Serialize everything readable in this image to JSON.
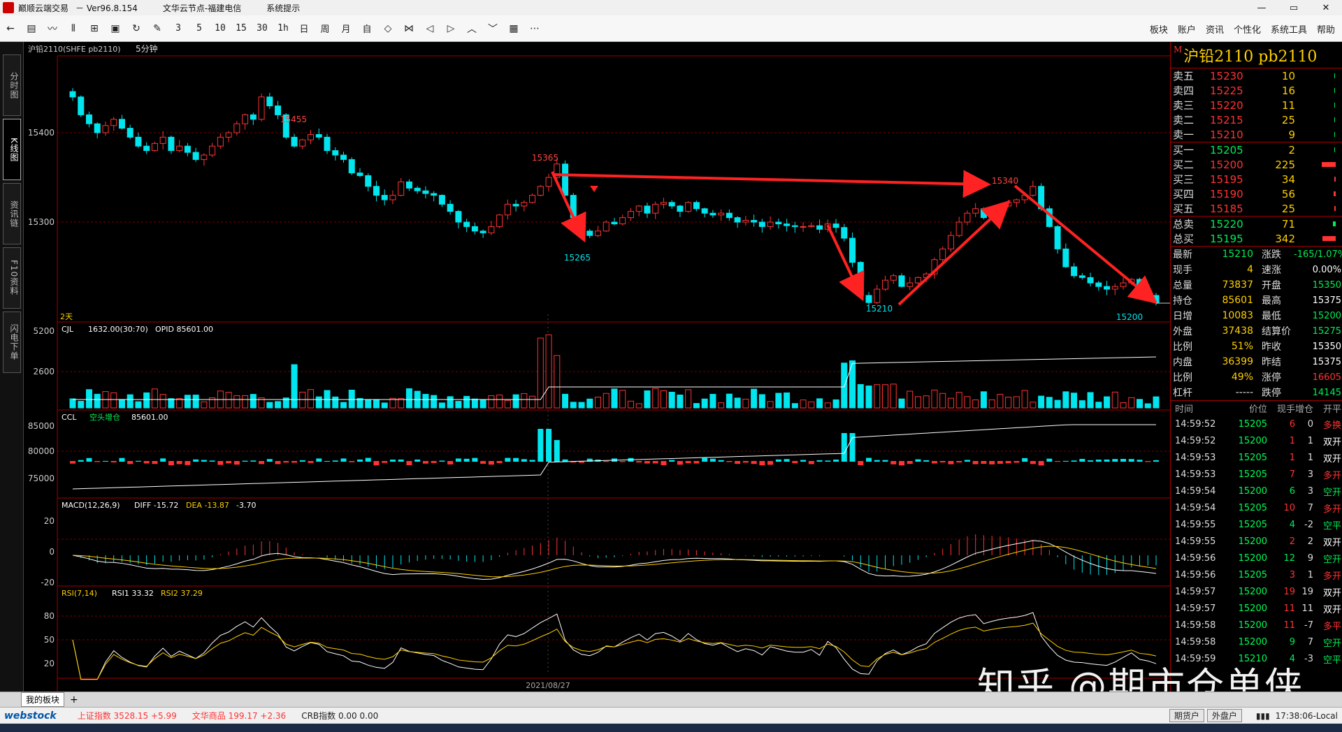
{
  "window": {
    "app_name": "巅顺云端交易",
    "version": "－ Ver96.8.154",
    "server": "文华云节点-福建电信",
    "menu_label": "系统提示",
    "buttons": [
      "—",
      "▭",
      "✕"
    ]
  },
  "toolbar": {
    "icons": [
      "back-icon",
      "home-icon",
      "line-chart-icon",
      "compare-icon",
      "split-icon",
      "save-icon",
      "refresh-icon",
      "draw-icon"
    ],
    "periods": [
      "3",
      "5",
      "10",
      "15",
      "30",
      "1h",
      "日",
      "周",
      "月",
      "自"
    ],
    "tail_icons": [
      "diamond-icon",
      "bowtie-icon",
      "prev-icon",
      "next-icon",
      "up-icon",
      "down-icon",
      "layout-icon",
      "more-icon"
    ],
    "menu": [
      "板块",
      "账户",
      "资讯",
      "个性化",
      "系统工具",
      "帮助"
    ]
  },
  "left_tabs": [
    "分时图",
    "K线图",
    "资讯链",
    "F10资料",
    "闪电下单"
  ],
  "chart_header": {
    "symbol": "沪铅2110(SHFE pb2110)",
    "period": "5分钟"
  },
  "chart_data": {
    "type": "candlestick",
    "y_ticks": [
      "15400",
      "15300"
    ],
    "annotations": {
      "high1": "15455",
      "peak2": "15365",
      "low1": "15265",
      "peak3": "15340",
      "low2": "15210",
      "low3": "15200"
    },
    "period_label": "2天",
    "x_label": "2021/08/27",
    "closes": [
      15440,
      15420,
      15410,
      15400,
      15408,
      15415,
      15405,
      15395,
      15385,
      15380,
      15388,
      15395,
      15380,
      15385,
      15378,
      15370,
      15375,
      15385,
      15395,
      15400,
      15410,
      15420,
      15415,
      15440,
      15430,
      15420,
      15395,
      15385,
      15392,
      15398,
      15395,
      15380,
      15375,
      15370,
      15355,
      15352,
      15340,
      15330,
      15325,
      15330,
      15345,
      15338,
      15335,
      15332,
      15330,
      15320,
      15312,
      15300,
      15295,
      15290,
      15288,
      15295,
      15308,
      15320,
      15318,
      15322,
      15330,
      15340,
      15350,
      15365,
      15330,
      15305,
      15290,
      15285,
      15290,
      15300,
      15298,
      15305,
      15312,
      15318,
      15310,
      15320,
      15322,
      15318,
      15312,
      15322,
      15315,
      15310,
      15308,
      15310,
      15305,
      15300,
      15302,
      15300,
      15295,
      15300,
      15298,
      15296,
      15295,
      15295,
      15296,
      15292,
      15298,
      15294,
      15282,
      15255,
      15218,
      15210,
      15225,
      15235,
      15240,
      15228,
      15232,
      15238,
      15242,
      15258,
      15270,
      15285,
      15300,
      15310,
      15315,
      15305,
      15312,
      15318,
      15322,
      15325,
      15330,
      15340,
      15315,
      15295,
      15270,
      15250,
      15240,
      15238,
      15232,
      15228,
      15225,
      15228,
      15232,
      15236,
      15222,
      15218,
      15210
    ],
    "volume_series": {
      "name": "CJL",
      "values_label": "1632.00(30:70)",
      "extra": "OPID 85601.00",
      "ticks": [
        "5200",
        "2600"
      ]
    },
    "oi_series": {
      "name": "CCL",
      "tag": "空头增仓",
      "value": "85601.00",
      "ticks": [
        "85000",
        "80000",
        "75000"
      ]
    },
    "macd": {
      "name": "MACD(12,26,9)",
      "diff": "DIFF -15.72",
      "dea": "DEA -13.87",
      "macd": "-3.70",
      "ticks": [
        "20",
        "0",
        "-20"
      ]
    },
    "rsi": {
      "name": "RSI(7,14)",
      "rsi1": "RSI1 33.32",
      "rsi2": "RSI2 37.29",
      "ticks": [
        "80",
        "50",
        "20"
      ]
    }
  },
  "quote": {
    "tag": "M",
    "title": "沪铅2110  pb2110",
    "asks": [
      {
        "label": "卖五",
        "price": "15230",
        "qty": "10",
        "bar": 0
      },
      {
        "label": "卖四",
        "price": "15225",
        "qty": "16",
        "bar": 0
      },
      {
        "label": "卖三",
        "price": "15220",
        "qty": "11",
        "bar": 0
      },
      {
        "label": "卖二",
        "price": "15215",
        "qty": "25",
        "bar": 0
      },
      {
        "label": "卖一",
        "price": "15210",
        "qty": "9",
        "bar": 0
      }
    ],
    "bids": [
      {
        "label": "买一",
        "price": "15205",
        "qty": "2",
        "bar": 0
      },
      {
        "label": "买二",
        "price": "15200",
        "qty": "225",
        "bar": 0.9
      },
      {
        "label": "买三",
        "price": "15195",
        "qty": "34",
        "bar": 0.1
      },
      {
        "label": "买四",
        "price": "15190",
        "qty": "56",
        "bar": 0.15
      },
      {
        "label": "买五",
        "price": "15185",
        "qty": "25",
        "bar": 0.08
      }
    ],
    "totals": [
      {
        "label": "总卖",
        "price": "15220",
        "qty": "71",
        "bar": 0.15
      },
      {
        "label": "总买",
        "price": "15195",
        "qty": "342",
        "bar": 0.85
      }
    ],
    "stats": [
      {
        "l1": "最新",
        "v1": "15210",
        "l2": "涨跌",
        "v2": "-165/1.07%"
      },
      {
        "l1": "现手",
        "v1": "4",
        "l2": "速涨",
        "v2": "0.00%"
      },
      {
        "l1": "总量",
        "v1": "73837",
        "l2": "开盘",
        "v2": "15350"
      },
      {
        "l1": "持仓",
        "v1": "85601",
        "l2": "最高",
        "v2": "15375"
      },
      {
        "l1": "日增",
        "v1": "10083",
        "l2": "最低",
        "v2": "15200"
      },
      {
        "l1": "外盘",
        "v1": "37438",
        "l2": "结算价",
        "v2": "15275"
      },
      {
        "l1": "比例",
        "v1": "51%",
        "l2": "昨收",
        "v2": "15350"
      },
      {
        "l1": "内盘",
        "v1": "36399",
        "l2": "昨结",
        "v2": "15375"
      },
      {
        "l1": "比例",
        "v1": "49%",
        "l2": "涨停",
        "v2": "16605"
      },
      {
        "l1": "杠杆",
        "v1": "-----",
        "l2": "跌停",
        "v2": "14145"
      }
    ],
    "trades_header": [
      "时间",
      "价位",
      "现手",
      "增仓",
      "开平"
    ],
    "trades": [
      {
        "t": "14:59:52",
        "p": "15205",
        "v": "6",
        "z": "0",
        "k": "多换"
      },
      {
        "t": "14:59:52",
        "p": "15200",
        "v": "1",
        "z": "1",
        "k": "双开"
      },
      {
        "t": "14:59:53",
        "p": "15205",
        "v": "1",
        "z": "1",
        "k": "双开"
      },
      {
        "t": "14:59:53",
        "p": "15205",
        "v": "7",
        "z": "3",
        "k": "多开"
      },
      {
        "t": "14:59:54",
        "p": "15200",
        "v": "6",
        "z": "3",
        "k": "空开"
      },
      {
        "t": "14:59:54",
        "p": "15205",
        "v": "10",
        "z": "7",
        "k": "多开"
      },
      {
        "t": "14:59:55",
        "p": "15205",
        "v": "4",
        "z": "-2",
        "k": "空平"
      },
      {
        "t": "14:59:55",
        "p": "15200",
        "v": "2",
        "z": "2",
        "k": "双开"
      },
      {
        "t": "14:59:56",
        "p": "15200",
        "v": "12",
        "z": "9",
        "k": "空开"
      },
      {
        "t": "14:59:56",
        "p": "15205",
        "v": "3",
        "z": "1",
        "k": "多开"
      },
      {
        "t": "14:59:57",
        "p": "15200",
        "v": "19",
        "z": "19",
        "k": "双开"
      },
      {
        "t": "14:59:57",
        "p": "15200",
        "v": "11",
        "z": "11",
        "k": "双开"
      },
      {
        "t": "14:59:58",
        "p": "15200",
        "v": "11",
        "z": "-7",
        "k": "多平"
      },
      {
        "t": "14:59:58",
        "p": "15200",
        "v": "9",
        "z": "7",
        "k": "空开"
      },
      {
        "t": "14:59:59",
        "p": "15210",
        "v": "4",
        "z": "-3",
        "k": "空平"
      }
    ]
  },
  "bottom": {
    "tab": "我的板块",
    "plus": "+",
    "logo": "webstock",
    "indices": [
      {
        "name": "上证指数",
        "value": "3528.15 +5.99"
      },
      {
        "name": "文华商品",
        "value": "199.17 +2.36"
      },
      {
        "name": "CRB指数",
        "value": "0.00 0.00"
      }
    ],
    "right_buttons": [
      "期货户",
      "外盘户"
    ],
    "clock": "17:38:06-Local"
  },
  "watermark": "知乎 @期市仓单侠",
  "colors": {
    "up": "#ff3333",
    "down": "#00e5ee",
    "grid": "#a00000",
    "arrow": "#ff2222",
    "label": "#ffd000"
  }
}
